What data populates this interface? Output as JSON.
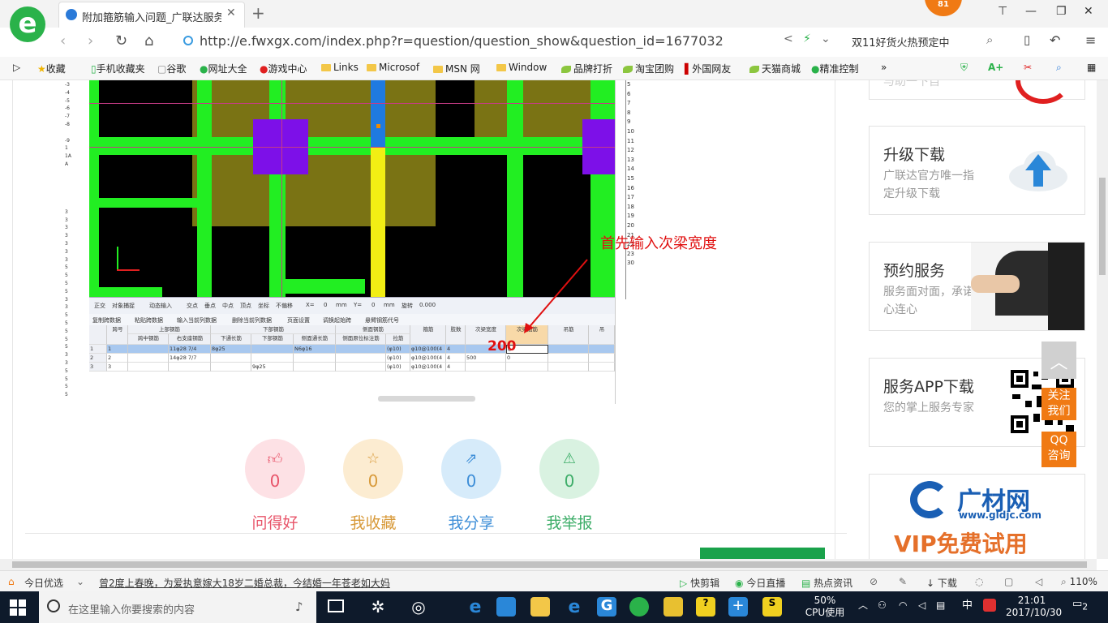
{
  "browser": {
    "tab_title": "附加箍筋输入问题_广联达服务新干线",
    "address": "http://e.fwxgx.com/index.php?r=question/question_show&question_id=1677032",
    "hot_search": "双11好货火热预定中",
    "badge_count": "81",
    "bookmarks": [
      "收藏",
      "手机收藏夹",
      "谷歌",
      "网址大全",
      "游戏中心",
      "Links",
      "Microsof",
      "MSN 网",
      "Window",
      "品牌打折",
      "淘宝团购",
      "外国网友",
      "天猫商城",
      "精准控制"
    ]
  },
  "screenshot": {
    "annotation": "首先输入次梁宽度",
    "typed_value": "200",
    "toolbar_items": [
      "正交",
      "对象捕捉",
      "动态输入",
      "交点",
      "垂点",
      "中点",
      "顶点",
      "坐标",
      "不偏移",
      "X=",
      "0",
      "mm",
      "Y=",
      "0",
      "mm",
      "旋转",
      "0.000"
    ],
    "toolbar2_items": [
      "复制跨数据",
      "粘贴跨数据",
      "输入当前列数据",
      "删除当前列数据",
      "页面设置",
      "调换起始跨",
      "悬臂钢筋代号"
    ],
    "group_headers": [
      "上部钢筋",
      "下部钢筋",
      "侧面钢筋"
    ],
    "columns": [
      "跨号",
      "跨中钢筋",
      "右支座钢筋",
      "下通长筋",
      "下部钢筋",
      "侧面通长筋",
      "侧面原位标注筋",
      "拉筋",
      "箍筋",
      "肢数",
      "次梁宽度",
      "次梁加筋",
      "吊筋",
      "吊"
    ],
    "rows": [
      {
        "idx": "1",
        "span": "1",
        "right": "",
        "bottom_long": "",
        "bottom": "",
        "side_long": "",
        "tie": "(φ10)",
        "stirrup": "φ10@100(4",
        "legs": "4",
        "width": "",
        "add": "0"
      },
      {
        "idx": "2",
        "span": "2",
        "right": "14φ28 7/7",
        "bottom_long": "",
        "bottom": "",
        "side_long": "",
        "tie": "(φ10)",
        "stirrup": "φ10@100(4",
        "legs": "4",
        "width": "500",
        "add": "0"
      },
      {
        "idx": "3",
        "span": "3",
        "right": "",
        "bottom_long": "",
        "bottom": "9φ25",
        "side_long": "",
        "tie": "(φ10)",
        "stirrup": "φ10@100(4",
        "legs": "4",
        "width": "",
        "add": ""
      }
    ],
    "row1_right": "11φ28 7/4",
    "row1_bottom_long": "8φ25",
    "row1_side_long": "N6φ16",
    "left_ruler": [
      "-3",
      "-4",
      "-5",
      "-6",
      "-7",
      "-8",
      "",
      "-9",
      "1",
      "1A",
      "A",
      "",
      "",
      "",
      "",
      "",
      "3",
      "3",
      "3",
      "3",
      "3",
      "3",
      "3",
      "5",
      "5",
      "5",
      "5",
      "3",
      "3",
      "5",
      "5",
      "5",
      "5",
      "5",
      "3",
      "3",
      "5",
      "5",
      "5",
      "5"
    ],
    "right_ruler": [
      "5",
      "6",
      "7",
      "8",
      "9",
      "10",
      "11",
      "12",
      "13",
      "14",
      "15",
      "16",
      "17",
      "18",
      "19",
      "20",
      "21",
      "22",
      "23",
      "30"
    ]
  },
  "stats": [
    {
      "icon": "thumbs-up",
      "count": "0",
      "label": "问得好",
      "color": "#e8556a",
      "bg": "#fde1e5"
    },
    {
      "icon": "star",
      "count": "0",
      "label": "我收藏",
      "color": "#d89a3a",
      "bg": "#fcecd1"
    },
    {
      "icon": "share",
      "count": "0",
      "label": "我分享",
      "color": "#3f8fd8",
      "bg": "#d6ebfa"
    },
    {
      "icon": "warning",
      "count": "0",
      "label": "我举报",
      "color": "#3fae6a",
      "bg": "#d9f2e1"
    }
  ],
  "sidebar": {
    "upgrade": {
      "title": "升级下载",
      "desc": "广联达官方唯一指定升级下载"
    },
    "appointment": {
      "title": "预约服务",
      "desc": "服务面对面，承诺心连心"
    },
    "app": {
      "title": "服务APP下载",
      "desc": "您的掌上服务专家"
    },
    "top_partial": "与助一下自",
    "ad_brand": "广材网",
    "ad_url": "www.gldjc.com",
    "ad_vip": "VIP免费试用",
    "follow": "关注我们",
    "qq": "QQ咨询"
  },
  "statusbar": {
    "today": "今日优选",
    "news": "曾2度上春晚，为爱执意嫁大18岁二婚总裁，今结婚一年苍老如大妈",
    "items": [
      "快剪辑",
      "今日直播",
      "热点资讯",
      "下载"
    ],
    "zoom": "110%"
  },
  "taskbar": {
    "search_placeholder": "在这里输入你要搜索的内容",
    "cpu": "50%",
    "cpu_label": "CPU使用",
    "ime": "中",
    "time": "21:01",
    "date": "2017/10/30",
    "notifications": "2"
  }
}
